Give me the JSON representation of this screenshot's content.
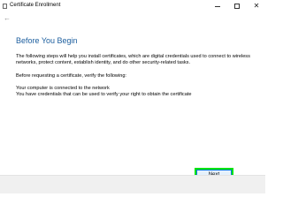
{
  "window": {
    "title": "Certificate Enrollment",
    "controls": {
      "minimize": "—",
      "maximize": "□",
      "close": "✕"
    }
  },
  "page": {
    "heading": "Before You Begin",
    "intro": "The following steps will help you install certificates, which are digital credentials used to connect to wireless networks, protect content, establish identity, and do other security-related tasks.",
    "verify_prompt": "Before requesting a certificate, verify the following:",
    "requirements": [
      "Your computer is connected to the network",
      "You have credentials that can be used to verify your right to obtain the certificate"
    ]
  },
  "footer": {
    "next_label": "Next"
  },
  "colors": {
    "heading": "#1c5e9e",
    "highlight": "#00e400",
    "footer_bg": "#f0f0f0"
  },
  "icons": {
    "window_icon": "certificate-icon",
    "back": "back-arrow-icon"
  }
}
